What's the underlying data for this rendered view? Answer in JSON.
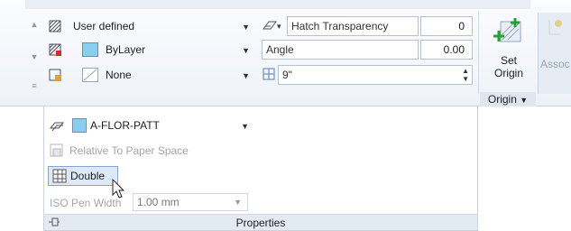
{
  "ribbon": {
    "left_col": [
      {
        "icon": "hatch-type-icon",
        "label": "User defined"
      },
      {
        "icon": "hatch-color-icon",
        "label": "ByLayer",
        "swatch": "#87cfee"
      },
      {
        "icon": "background-color-icon",
        "label": "None"
      }
    ],
    "right_col": {
      "transparency_label": "Hatch Transparency",
      "transparency_value": "0",
      "angle_label": "Angle",
      "angle_value": "0.00",
      "spacing_value": "9\""
    },
    "origin": {
      "button_label_line1": "Set",
      "button_label_line2": "Origin",
      "footer_label": "Origin",
      "assoc_label": "Assoc"
    }
  },
  "panel": {
    "layer_label": "A-FLOR-PATT",
    "layer_swatch": "#87cfee",
    "relative_label": "Relative To Paper Space",
    "double_label": "Double",
    "iso_label": "ISO Pen Width",
    "iso_value": "1.00 mm",
    "footer_title": "Properties"
  },
  "colors": {
    "accent": "#86a6d0",
    "green_plus": "#21a330"
  }
}
